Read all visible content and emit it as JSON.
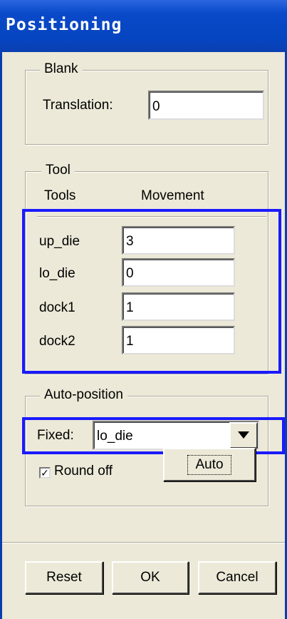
{
  "window": {
    "title": "Positioning"
  },
  "blank": {
    "legend": "Blank",
    "translation_label": "Translation:",
    "translation_value": "0"
  },
  "tool": {
    "legend": "Tool",
    "col_tools": "Tools",
    "col_movement": "Movement",
    "rows": [
      {
        "name": "up_die",
        "value": "3"
      },
      {
        "name": "lo_die",
        "value": "0"
      },
      {
        "name": "dock1",
        "value": "1"
      },
      {
        "name": "dock2",
        "value": "1"
      }
    ]
  },
  "auto_position": {
    "legend": "Auto-position",
    "fixed_label": "Fixed:",
    "fixed_value": "lo_die",
    "round_off_label": "Round off",
    "round_off_checked": true,
    "auto_label": "Auto"
  },
  "footer": {
    "reset_label": "Reset",
    "ok_label": "OK",
    "cancel_label": "Cancel"
  },
  "colors": {
    "titlebar": "#0645c0",
    "highlight": "#1a1aff",
    "face": "#ece9d8"
  }
}
